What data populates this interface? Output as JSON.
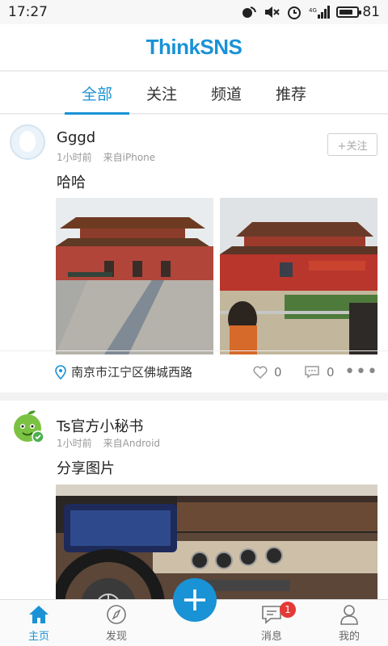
{
  "status_bar": {
    "time": "17:27",
    "battery": "81",
    "battery_level": 0.81
  },
  "header": {
    "logo": "ThinkSNS"
  },
  "tabs": [
    {
      "label": "全部",
      "active": true
    },
    {
      "label": "关注",
      "active": false
    },
    {
      "label": "频道",
      "active": false
    },
    {
      "label": "推荐",
      "active": false
    }
  ],
  "posts": [
    {
      "username": "Gggd",
      "time": "1小时前",
      "source": "来自iPhone",
      "text": "哈哈",
      "follow_label": "+关注",
      "location": "南京市江宁区佛城西路",
      "likes": "0",
      "comments": "0"
    },
    {
      "username": "Ts官方小秘书",
      "time": "1小时前",
      "source": "来自Android",
      "text": "分享图片"
    }
  ],
  "bottom_nav": {
    "items": [
      {
        "label": "主页"
      },
      {
        "label": "发现"
      },
      {
        "label": "消息",
        "badge": "1"
      },
      {
        "label": "我的"
      }
    ]
  },
  "colors": {
    "accent": "#1a92d6",
    "badge": "#e53935"
  }
}
